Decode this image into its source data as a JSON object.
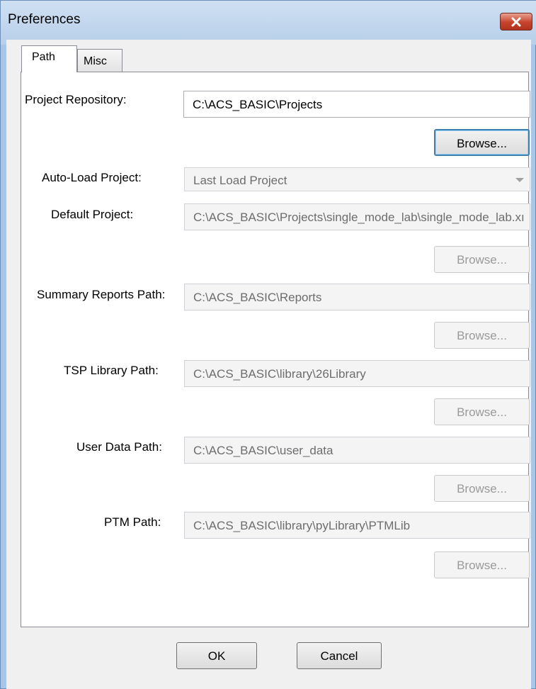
{
  "window": {
    "title": "Preferences"
  },
  "tabs": [
    {
      "label": "Path",
      "active": true
    },
    {
      "label": "Misc",
      "active": false
    }
  ],
  "path_tab": {
    "project_repository": {
      "label": "Project Repository:",
      "value": "C:\\ACS_BASIC\\Projects",
      "browse_label": "Browse..."
    },
    "auto_load_project": {
      "label": "Auto-Load Project:",
      "selected": "Last Load Project"
    },
    "default_project": {
      "label": "Default Project:",
      "value": "C:\\ACS_BASIC\\Projects\\single_mode_lab\\single_mode_lab.xı",
      "browse_label": "Browse..."
    },
    "summary_reports_path": {
      "label": "Summary Reports Path:",
      "value": "C:\\ACS_BASIC\\Reports",
      "browse_label": "Browse..."
    },
    "tsp_library_path": {
      "label": "TSP Library Path:",
      "value": "C:\\ACS_BASIC\\library\\26Library",
      "browse_label": "Browse..."
    },
    "user_data_path": {
      "label": "User Data Path:",
      "value": "C:\\ACS_BASIC\\user_data",
      "browse_label": "Browse..."
    },
    "ptm_path": {
      "label": "PTM Path:",
      "value": "C:\\ACS_BASIC\\library\\pyLibrary\\PTMLib",
      "browse_label": "Browse..."
    }
  },
  "footer": {
    "ok_label": "OK",
    "cancel_label": "Cancel"
  },
  "colors": {
    "title_bar": "#b7cfe9",
    "close_button": "#c5432c",
    "primary_button_border": "#3c7fb1"
  }
}
